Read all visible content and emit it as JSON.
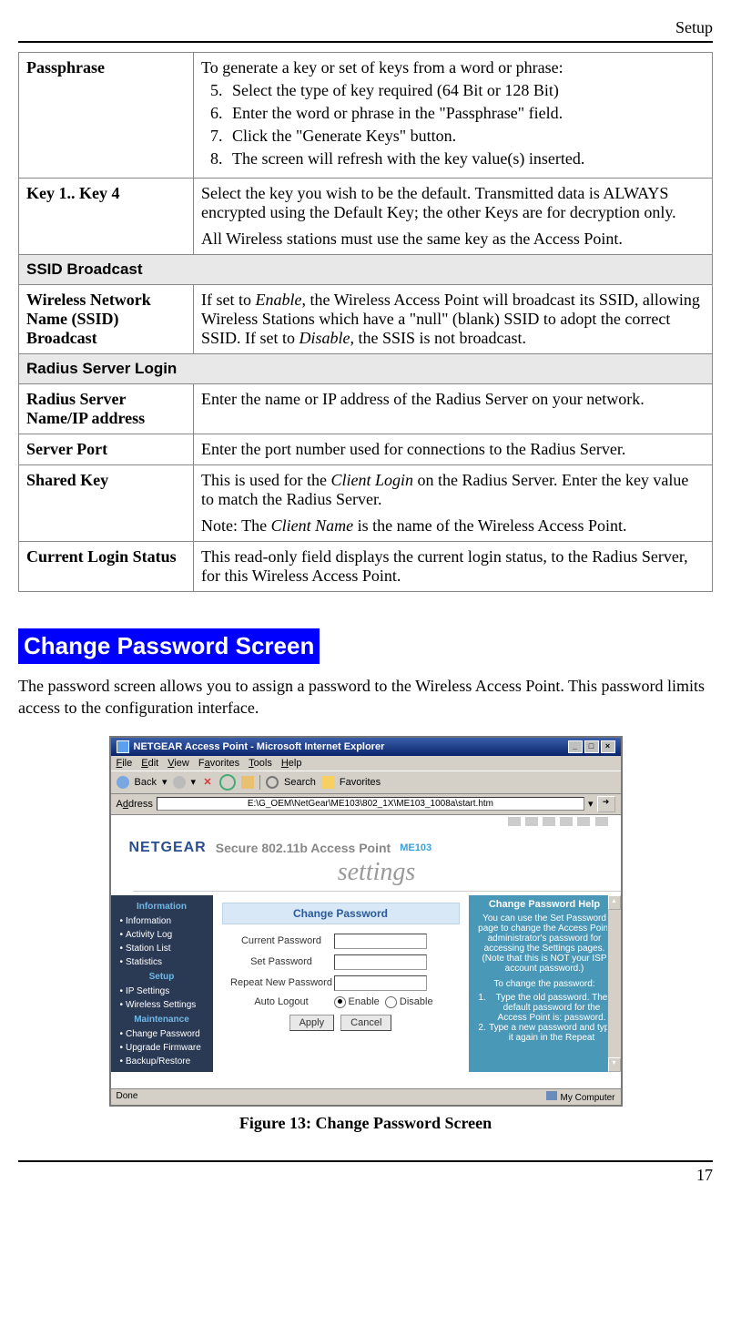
{
  "page_header": "Setup",
  "page_number": "17",
  "rows": {
    "passphrase_label": "Passphrase",
    "passphrase_intro": "To generate a key or set of keys from a word or phrase:",
    "passphrase_steps": [
      "Select the type of key required (64 Bit or 128 Bit)",
      "Enter the word or phrase in the \"Passphrase\" field.",
      "Click the \"Generate Keys\" button.",
      "The screen will refresh with the key value(s) inserted."
    ],
    "key_label": "Key 1.. Key 4",
    "key_p1": "Select the key you wish to be the default. Transmitted data is ALWAYS encrypted using the Default Key; the other Keys are for decryption only.",
    "key_p2": "All Wireless stations must use the same key as the Access Point.",
    "ssid_header": "SSID Broadcast",
    "ssid_label": "Wireless Network Name (SSID) Broadcast",
    "ssid_text_pre": "If set to ",
    "ssid_enable": "Enable",
    "ssid_text_mid": ", the Wireless Access Point will broadcast its SSID, allowing Wireless Stations which have a \"null\" (blank) SSID to adopt the correct SSID. If set to ",
    "ssid_disable": "Disable",
    "ssid_text_post": ", the SSIS is not broadcast.",
    "radius_header": "Radius Server Login",
    "radius_name_label": "Radius Server Name/IP address",
    "radius_name_text": "Enter the name or IP address of the Radius Server on your network.",
    "server_port_label": "Server Port",
    "server_port_text": "Enter the port number used for connections to the Radius Server.",
    "shared_key_label": "Shared Key",
    "shared_key_p1a": "This is used for the ",
    "shared_key_p1b": "Client Login",
    "shared_key_p1c": " on the Radius Server. Enter the key value to match the Radius Server.",
    "shared_key_p2a": "Note: The ",
    "shared_key_p2b": "Client Name",
    "shared_key_p2c": " is the name of the Wireless Access Point.",
    "status_label": "Current Login Status",
    "status_text": "This read-only field displays the current login status, to the Radius Server, for this Wireless Access Point."
  },
  "heading": "Change Password Screen",
  "intro_para": "The password screen allows you to assign a password to the Wireless Access Point. This password limits access to the configuration interface.",
  "figure_caption": "Figure 13:  Change Password Screen",
  "screenshot": {
    "title": "NETGEAR Access Point - Microsoft Internet Explorer",
    "menu": {
      "file": "File",
      "edit": "Edit",
      "view": "View",
      "favorites": "Favorites",
      "tools": "Tools",
      "help": "Help"
    },
    "toolbar": {
      "back": "Back",
      "search": "Search",
      "favorites": "Favorites"
    },
    "address_label": "Address",
    "address_value": "E:\\G_OEM\\NetGear\\ME103\\802_1X\\ME103_1008a\\start.htm",
    "go": "Go",
    "brand": "NETGEAR",
    "ap_text": "Secure 802.11b Access Point",
    "model": "ME103",
    "settings_word": "settings",
    "sidebar": {
      "info_head": "Information",
      "info": [
        "Information",
        "Activity Log",
        "Station List",
        "Statistics"
      ],
      "setup_head": "Setup",
      "setup": [
        "IP Settings",
        "Wireless Settings"
      ],
      "maint_head": "Maintenance",
      "maint": [
        "Change Password",
        "Upgrade Firmware",
        "Backup/Restore"
      ]
    },
    "panel_title": "Change Password",
    "form": {
      "current": "Current Password",
      "set": "Set Password",
      "repeat": "Repeat New Password",
      "auto": "Auto Logout",
      "enable": "Enable",
      "disable": "Disable",
      "apply": "Apply",
      "cancel": "Cancel"
    },
    "help": {
      "title": "Change Password Help",
      "p1": "You can use the Set Password page to change the Access Point administrator's password for accessing the Settings pages. (Note that this is NOT your ISP account password.)",
      "p2": "To change the password:",
      "li1": "Type the old password. The default password for the Access Point is: password.",
      "li2": "Type a new password and type it again in the Repeat"
    },
    "status_done": "Done",
    "status_comp": "My Computer"
  }
}
